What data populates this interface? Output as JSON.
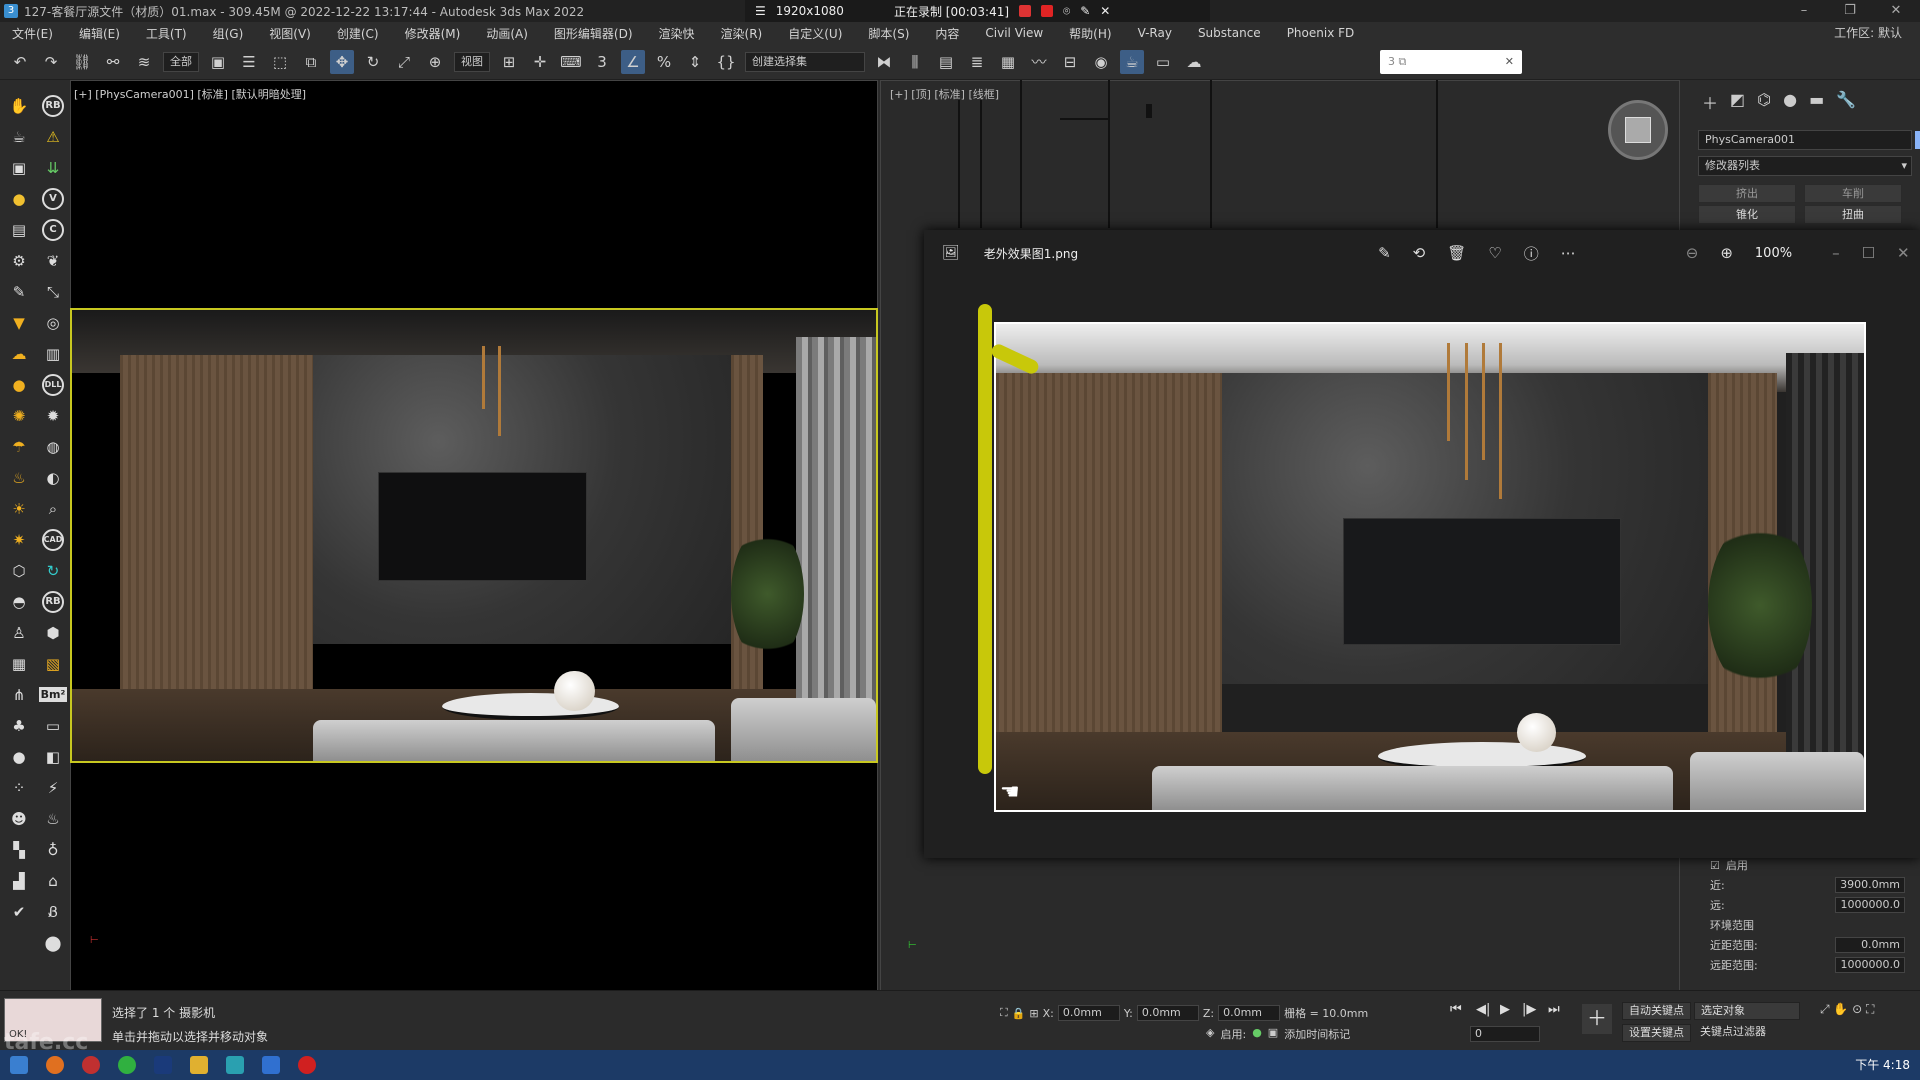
{
  "titlebar": {
    "title": "127-客餐厅源文件（材质）01.max - 309.45M @ 2022-12-22 13:17:44 - Autodesk 3ds Max 2022",
    "resolution": "1920x1080",
    "recording": "正在录制 [00:03:41]"
  },
  "menu": [
    "文件(E)",
    "编辑(E)",
    "工具(T)",
    "组(G)",
    "视图(V)",
    "创建(C)",
    "修改器(M)",
    "动画(A)",
    "图形编辑器(D)",
    "渲染(R)",
    "自定义(U)",
    "脚本(S)",
    "内容",
    "Civil View",
    "帮助(H)",
    "V-Ray",
    "Substance",
    "Phoenix FD"
  ],
  "menu_extra": "渲染快",
  "workspace": "工作区: 默认",
  "toolbar": {
    "filter": "全部",
    "view": "视图",
    "selset": "创建选择集"
  },
  "left_badges": [
    "RB",
    "V",
    "C",
    "DLL",
    "CAD",
    "RB",
    "Bm²"
  ],
  "viewport_cam": {
    "label": "[+] [PhysCamera001] [标准] [默认明暗处理]"
  },
  "viewport_top": {
    "label": "[+] [顶] [标准] [线框]"
  },
  "cmdpanel": {
    "object": "PhysCamera001",
    "modlist": "修改器列表",
    "b1": "挤出",
    "b2": "车削",
    "b3": "锥化",
    "b4": "扭曲"
  },
  "params": {
    "enable": "启用",
    "near_label": "近:",
    "near": "3900.0mm",
    "far_label": "远:",
    "far": "1000000.0",
    "env": "环境范围",
    "env_near_label": "近距范围:",
    "env_near": "0.0mm",
    "env_far_label": "远距范围:",
    "env_far": "1000000.0"
  },
  "viewer": {
    "filename": "老外效果图1.png",
    "zoom": "100%"
  },
  "status": {
    "selected": "选择了 1 个 摄影机",
    "hint": "单击并拖动以选择并移动对象",
    "thumb": "OK!",
    "x": "0.0mm",
    "y": "0.0mm",
    "z": "0.0mm",
    "grid": "栅格 = 10.0mm",
    "autokey": "自动关键点",
    "setkey": "设置关键点",
    "selobj": "选定对象",
    "keyfilter": "关键点过滤器",
    "frame": "0",
    "enable": "启用:",
    "addtime": "添加时间标记"
  },
  "clock": "下午 4:18",
  "watermark": "tafe.cc"
}
